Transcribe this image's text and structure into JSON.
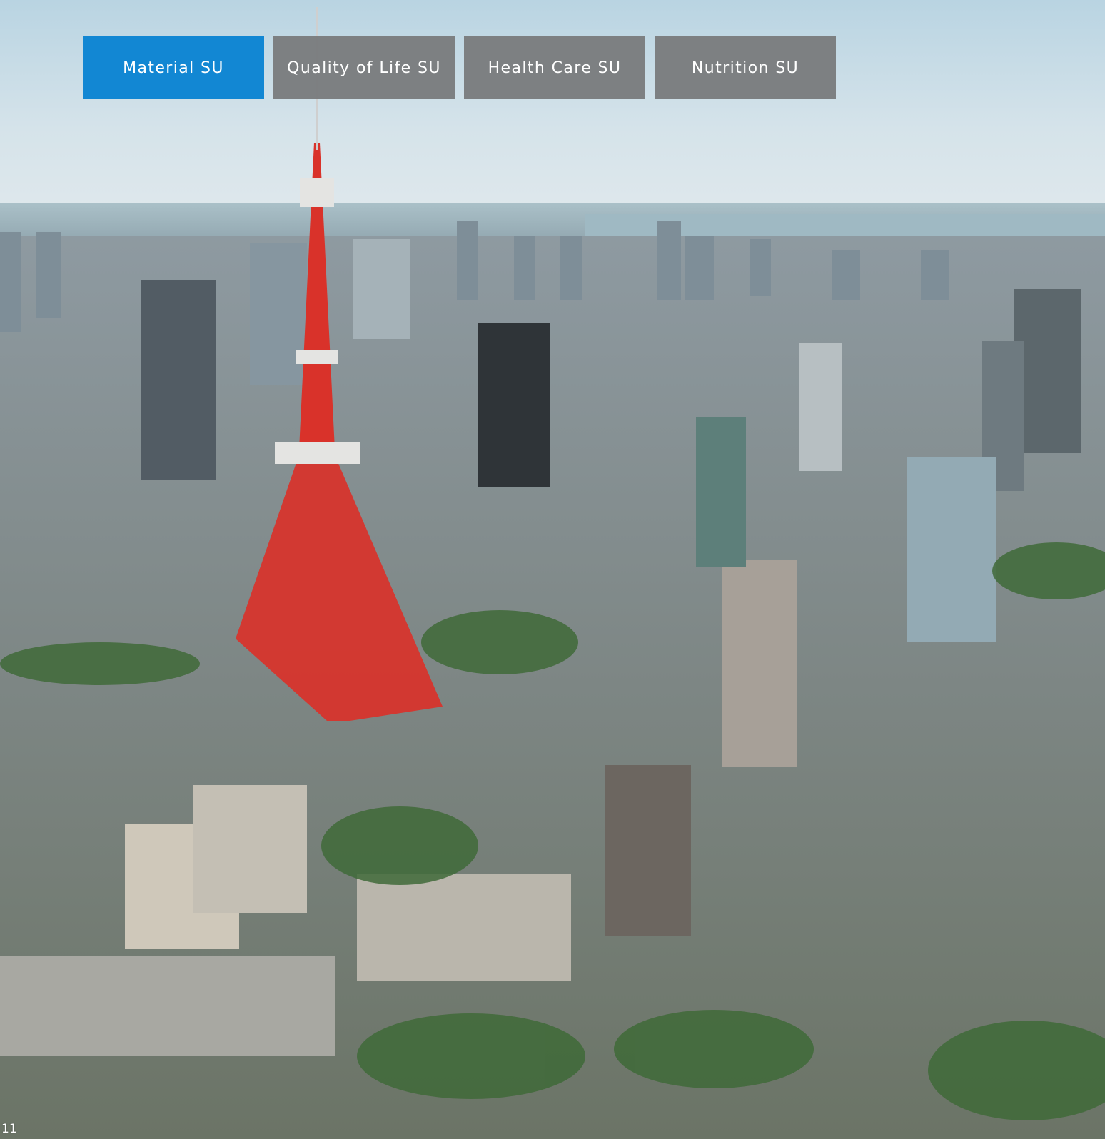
{
  "tabs": [
    {
      "label": "Material SU",
      "active": true
    },
    {
      "label": "Quality of Life SU",
      "active": false
    },
    {
      "label": "Health Care SU",
      "active": false
    },
    {
      "label": "Nutrition SU",
      "active": false
    }
  ],
  "colors": {
    "active_tab": "#1287d3",
    "inactive_tab": "#7a7c7e",
    "tab_text": "#ffffff",
    "tower_red": "#d9322a"
  },
  "photo": {
    "content_icon": "city-skyline-photo"
  },
  "footer": {
    "page_number": "11"
  }
}
